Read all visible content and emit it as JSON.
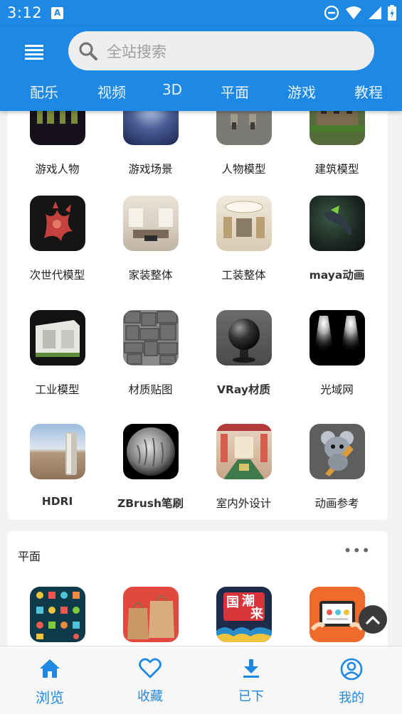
{
  "status_bar": {
    "time": "3:12",
    "notif_letter": "A"
  },
  "search": {
    "placeholder": "全站搜索"
  },
  "tabs": [
    {
      "label": "配乐"
    },
    {
      "label": "视频"
    },
    {
      "label": "3D"
    },
    {
      "label": "平面"
    },
    {
      "label": "游戏"
    },
    {
      "label": "教程"
    }
  ],
  "section_3d": {
    "items": [
      {
        "label": "游戏人物"
      },
      {
        "label": "游戏场景"
      },
      {
        "label": "人物模型"
      },
      {
        "label": "建筑模型"
      },
      {
        "label": "次世代模型"
      },
      {
        "label": "家装整体"
      },
      {
        "label": "工装整体"
      },
      {
        "label": "maya动画"
      },
      {
        "label": "工业模型"
      },
      {
        "label": "材质贴图"
      },
      {
        "label": "VRay材质"
      },
      {
        "label": "光域网"
      },
      {
        "label": "HDRI"
      },
      {
        "label": "ZBrush笔刷"
      },
      {
        "label": "室内外设计"
      },
      {
        "label": "动画参考"
      }
    ]
  },
  "section_flat": {
    "title": "平面",
    "more": "•••"
  },
  "bottom_nav": [
    {
      "label": "浏览",
      "icon": "home-icon"
    },
    {
      "label": "收藏",
      "icon": "heart-icon"
    },
    {
      "label": "已下",
      "icon": "download-icon"
    },
    {
      "label": "我的",
      "icon": "account-icon"
    }
  ],
  "colors": {
    "primary": "#1e88e5",
    "surface": "#ffffff",
    "background": "#f2f2f2"
  }
}
